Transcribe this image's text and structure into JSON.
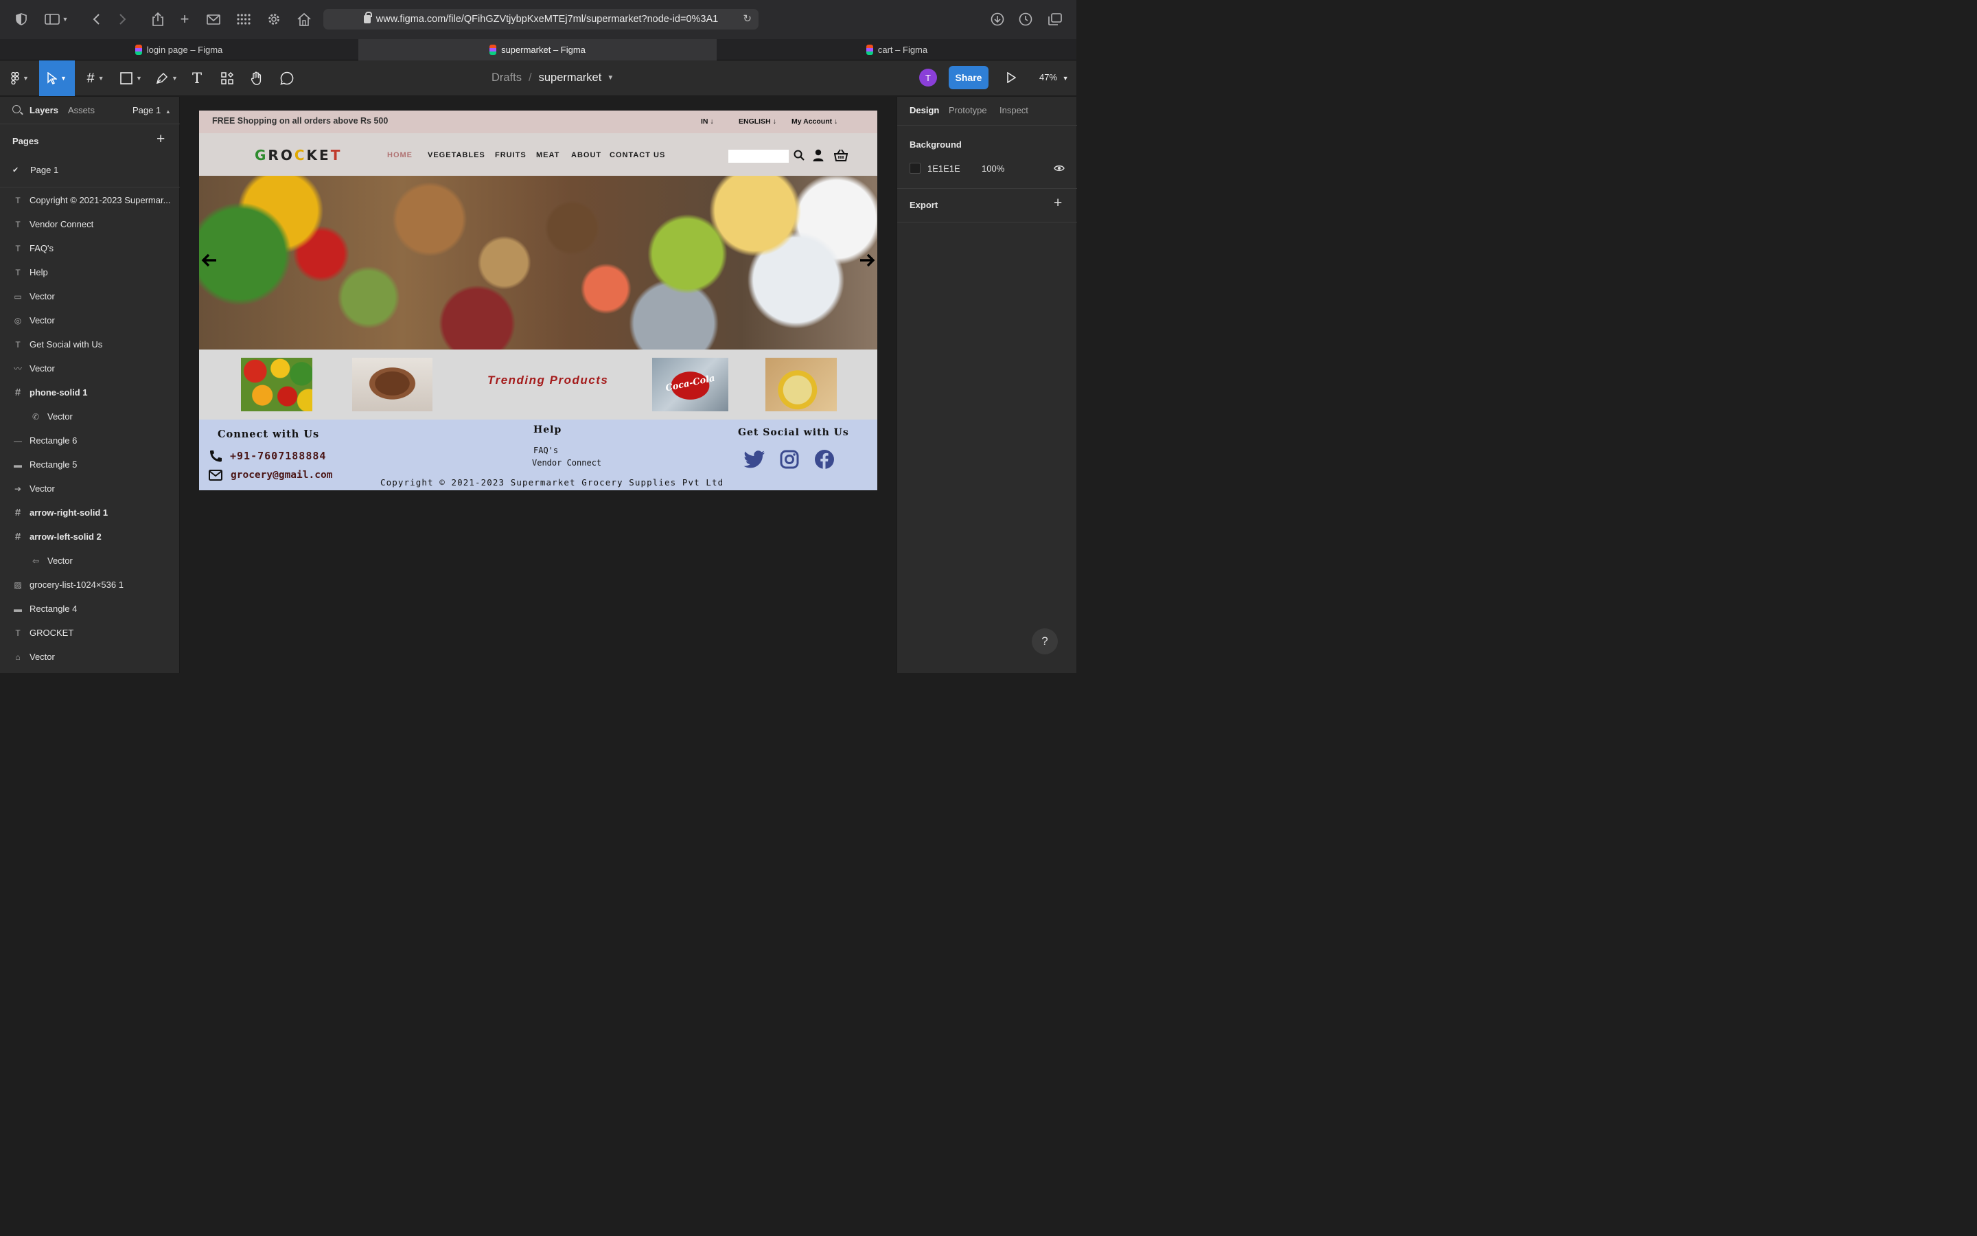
{
  "browser": {
    "url": "www.figma.com/file/QFihGZVtjybpKxeMTEj7ml/supermarket?node-id=0%3A1",
    "tabs": [
      {
        "label": "login page – Figma"
      },
      {
        "label": "supermarket – Figma"
      },
      {
        "label": "cart – Figma"
      }
    ]
  },
  "figma": {
    "breadcrumb": {
      "drafts": "Drafts",
      "separator": "/",
      "file": "supermarket"
    },
    "avatar_initial": "T",
    "share_label": "Share",
    "zoom": "47%"
  },
  "left_panel": {
    "tabs": {
      "layers": "Layers",
      "assets": "Assets",
      "page_select": "Page 1"
    },
    "pages_heading": "Pages",
    "pages": [
      {
        "label": "Page 1",
        "selected": true
      }
    ],
    "layers": [
      {
        "label": "Copyright © 2021-2023 Supermar...",
        "type": "text"
      },
      {
        "label": "Vendor Connect",
        "type": "text"
      },
      {
        "label": "FAQ's",
        "type": "text"
      },
      {
        "label": "Help",
        "type": "text"
      },
      {
        "label": "Vector",
        "type": "vector"
      },
      {
        "label": "Vector",
        "type": "vector"
      },
      {
        "label": "Get Social with Us",
        "type": "text"
      },
      {
        "label": "Vector",
        "type": "vector"
      },
      {
        "label": "phone-solid 1",
        "type": "frame"
      },
      {
        "label": "Vector",
        "type": "vector-child"
      },
      {
        "label": "Rectangle 6",
        "type": "rect"
      },
      {
        "label": "Rectangle 5",
        "type": "rect"
      },
      {
        "label": "Vector",
        "type": "vector"
      },
      {
        "label": "arrow-right-solid 1",
        "type": "frame"
      },
      {
        "label": "arrow-left-solid 2",
        "type": "frame"
      },
      {
        "label": "Vector",
        "type": "vector-child"
      },
      {
        "label": "grocery-list-1024×536 1",
        "type": "image"
      },
      {
        "label": "Rectangle 4",
        "type": "rect"
      },
      {
        "label": "GROCKET",
        "type": "text"
      },
      {
        "label": "Vector",
        "type": "vector"
      }
    ]
  },
  "right_panel": {
    "tabs": {
      "design": "Design",
      "prototype": "Prototype",
      "inspect": "Inspect"
    },
    "background_heading": "Background",
    "background_hex": "1E1E1E",
    "background_opacity": "100%",
    "export_heading": "Export",
    "help_label": "?"
  },
  "site": {
    "promo": "FREE Shopping on all orders above Rs 500",
    "region": "IN",
    "language": "ENGLISH",
    "account": "My Account",
    "logo_letters": [
      "G",
      "R",
      "O",
      "C",
      "K",
      "E",
      "T"
    ],
    "logo_colors": [
      "#2e8b2e",
      "#222222",
      "#222222",
      "#e0a800",
      "#222222",
      "#222222",
      "#c0392b"
    ],
    "nav": [
      {
        "label": "HOME"
      },
      {
        "label": "VEGETABLES"
      },
      {
        "label": "FRUITS"
      },
      {
        "label": "MEAT"
      },
      {
        "label": "ABOUT"
      },
      {
        "label": "CONTACT US"
      }
    ],
    "trending_title": "Trending Products",
    "coke_label": "Coca-Cola",
    "footer": {
      "connect_heading": "Connect with Us",
      "phone": "+91-7607188884",
      "email": "grocery@gmail.com",
      "help_heading": "Help",
      "faq": "FAQ's",
      "vendor": "Vendor Connect",
      "social_heading": "Get Social with Us",
      "copyright": "Copyright © 2021-2023 Supermarket Grocery Supplies Pvt Ltd"
    },
    "colors": {
      "footer_bg": "#c3cfea",
      "social_icon": "#3b4a8f",
      "accent_red": "#a41b1b"
    }
  }
}
